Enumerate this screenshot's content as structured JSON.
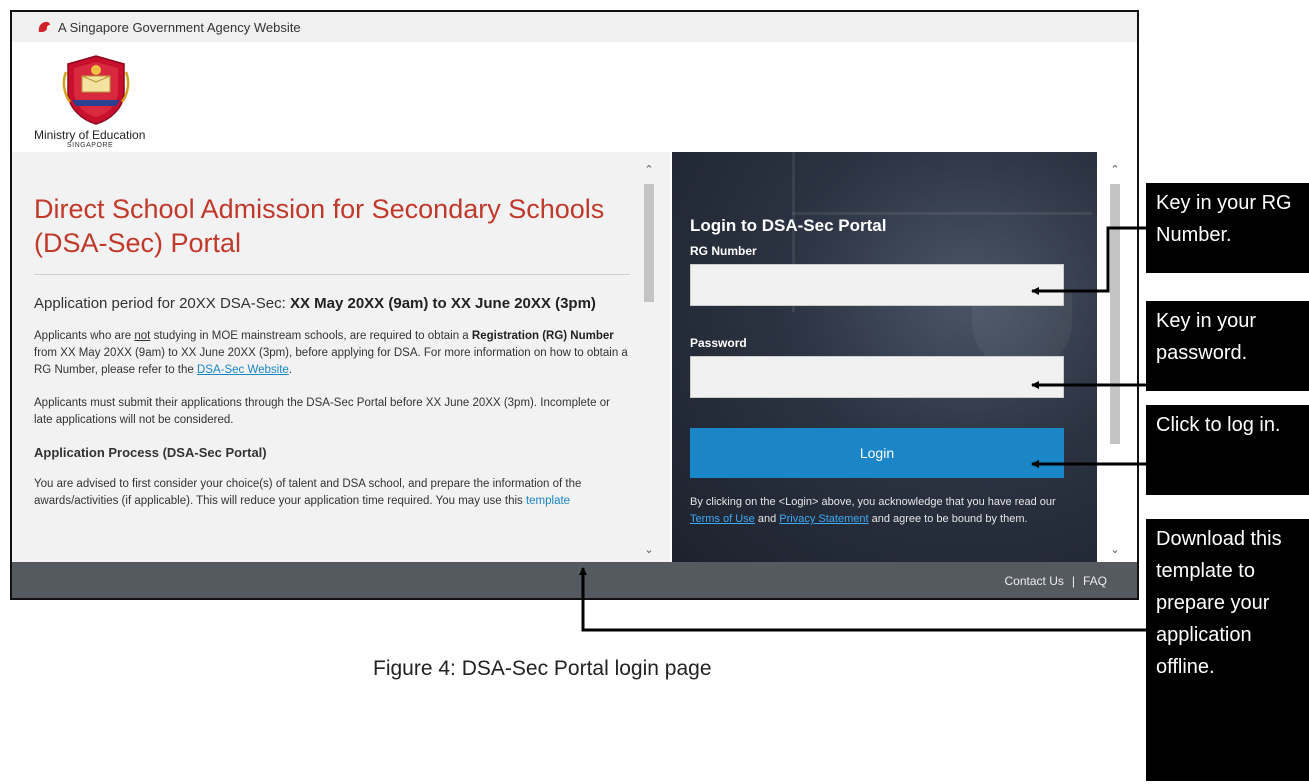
{
  "gov_bar": {
    "text": "A Singapore Government Agency Website"
  },
  "header": {
    "ministry_name": "Ministry of Education",
    "ministry_country": "SINGAPORE"
  },
  "main": {
    "title": "Direct School Admission for Secondary Schools (DSA-Sec) Portal",
    "application_period_prefix": "Application period for 20XX DSA-Sec: ",
    "application_period_dates": "XX May 20XX (9am) to XX June 20XX (3pm)",
    "para1_a": "Applicants who are ",
    "para1_not": "not",
    "para1_b": " studying in MOE mainstream schools, are required to obtain a ",
    "para1_bold": "Registration (RG) Number",
    "para1_c": " from XX May 20XX (9am) to XX June 20XX (3pm), before applying for DSA. For more information on how to obtain a RG Number, please refer to the ",
    "para1_link": "DSA-Sec Website",
    "para1_end": ".",
    "para2": "Applicants must submit their applications through the DSA-Sec Portal before XX June 20XX (3pm). Incomplete or late applications will not be considered.",
    "section_heading": "Application Process (DSA-Sec Portal)",
    "para3": "You are advised to first consider your choice(s) of talent and DSA school, and prepare the information of the awards/activities (if applicable). This will reduce your application time required. You may use this ",
    "para3_link": "template"
  },
  "login": {
    "title": "Login to DSA-Sec Portal",
    "rg_label": "RG Number",
    "rg_value": "",
    "password_label": "Password",
    "password_value": "",
    "button_label": "Login",
    "ack_a": "By clicking on the <Login> above, you acknowledge that you have read our ",
    "terms_link": "Terms of Use",
    "ack_and": " and ",
    "privacy_link": "Privacy Statement",
    "ack_b": " and agree to be bound by them."
  },
  "footer": {
    "contact": "Contact Us",
    "separator": "|",
    "faq": "FAQ"
  },
  "callouts": {
    "rg": "Key in your RG Number.",
    "password": "Key in your password.",
    "login": "Click to log in.",
    "template": "Download this template to prepare your application offline."
  },
  "caption": "Figure 4:  DSA-Sec Portal login page",
  "colors": {
    "title_red": "#c0392b",
    "login_blue": "#1a86c8",
    "footer_grey": "#555a61"
  }
}
